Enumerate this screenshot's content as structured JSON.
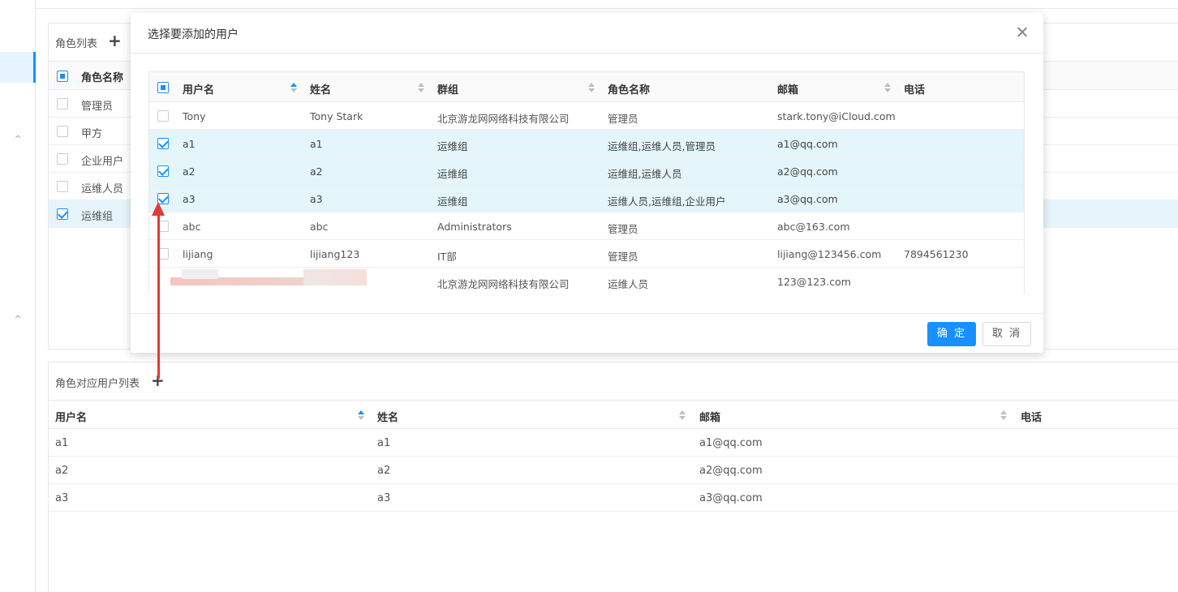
{
  "sidebar": {
    "chevrons": [
      "^",
      "^"
    ]
  },
  "role_panel": {
    "title": "角色列表",
    "header": "角色名称",
    "rows": [
      {
        "name": "管理员",
        "checked": false
      },
      {
        "name": "甲方",
        "checked": false
      },
      {
        "name": "企业用户",
        "checked": false
      },
      {
        "name": "运维人员",
        "checked": false
      },
      {
        "name": "运维组",
        "checked": true
      }
    ]
  },
  "user_panel": {
    "title": "角色对应用户列表",
    "columns": [
      "用户名",
      "姓名",
      "邮箱",
      "电话"
    ],
    "rows": [
      {
        "username": "a1",
        "name": "a1",
        "email": "a1@qq.com",
        "phone": ""
      },
      {
        "username": "a2",
        "name": "a2",
        "email": "a2@qq.com",
        "phone": ""
      },
      {
        "username": "a3",
        "name": "a3",
        "email": "a3@qq.com",
        "phone": ""
      }
    ]
  },
  "modal": {
    "title": "选择要添加的用户",
    "columns": [
      "用户名",
      "姓名",
      "群组",
      "角色名称",
      "邮箱",
      "电话"
    ],
    "rows": [
      {
        "checked": false,
        "username": "Tony",
        "name": "Tony Stark",
        "group": "北京游龙网网络科技有限公司",
        "role": "管理员",
        "email": "stark.tony@iCloud.com",
        "phone": ""
      },
      {
        "checked": true,
        "username": "a1",
        "name": "a1",
        "group": "运维组",
        "role": "运维组,运维人员,管理员",
        "email": "a1@qq.com",
        "phone": ""
      },
      {
        "checked": true,
        "username": "a2",
        "name": "a2",
        "group": "运维组",
        "role": "运维组,运维人员",
        "email": "a2@qq.com",
        "phone": ""
      },
      {
        "checked": true,
        "username": "a3",
        "name": "a3",
        "group": "运维组",
        "role": "运维人员,运维组,企业用户",
        "email": "a3@qq.com",
        "phone": ""
      },
      {
        "checked": false,
        "username": "abc",
        "name": "abc",
        "group": "Administrators",
        "role": "管理员",
        "email": "abc@163.com",
        "phone": ""
      },
      {
        "checked": false,
        "username": "lijiang",
        "name": "lijiang123",
        "group": "IT部",
        "role": "管理员",
        "email": "lijiang@123456.com",
        "phone": "7894561230"
      },
      {
        "checked": false,
        "username": "",
        "name": "",
        "group": "北京游龙网网络科技有限公司",
        "role": "运维人员",
        "email": "123@123.com",
        "phone": ""
      }
    ],
    "ok_label": "确 定",
    "cancel_label": "取 消"
  },
  "colors": {
    "accent": "#1890ff",
    "selected_row": "#e4f5fc",
    "arrow": "#e53935"
  }
}
